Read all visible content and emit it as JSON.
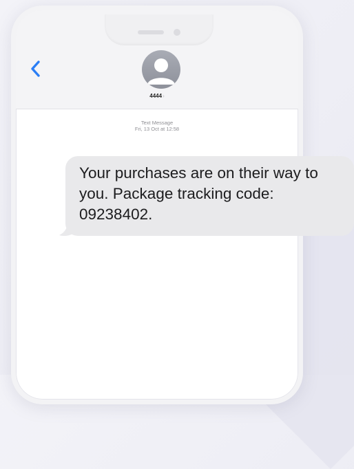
{
  "contact": {
    "name": "4444",
    "chevron": "›",
    "avatar_icon": "person-silhouette"
  },
  "thread": {
    "type_label": "Text Message",
    "timestamp": "Fri, 13 Oct at 12:58"
  },
  "message": {
    "text": "Your purchases are on their way to you. Package tracking code: 09238402."
  },
  "colors": {
    "accent": "#2b7ef5",
    "bubble": "#e9e9eb",
    "meta_text": "#8e8e93"
  },
  "icons": {
    "back": "chevron-left-icon"
  }
}
